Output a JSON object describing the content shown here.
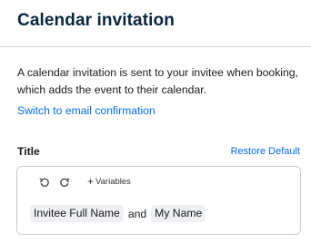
{
  "header": {
    "title": "Calendar invitation"
  },
  "main": {
    "description": "A calendar invitation is sent to your invitee when booking, which adds the event to their calendar.",
    "switch_link": "Switch to email confirmation"
  },
  "title_section": {
    "label": "Title",
    "restore_label": "Restore Default",
    "toolbar": {
      "undo_icon": "undo-icon",
      "redo_icon": "redo-icon",
      "variables_label": "Variables"
    },
    "content": {
      "variable_1": "Invitee Full Name",
      "connector": "and",
      "variable_2": "My Name"
    }
  },
  "colors": {
    "heading": "#0a2540",
    "link": "#006bff",
    "chip_bg": "#eef0f3",
    "border": "#c9c9c9"
  }
}
